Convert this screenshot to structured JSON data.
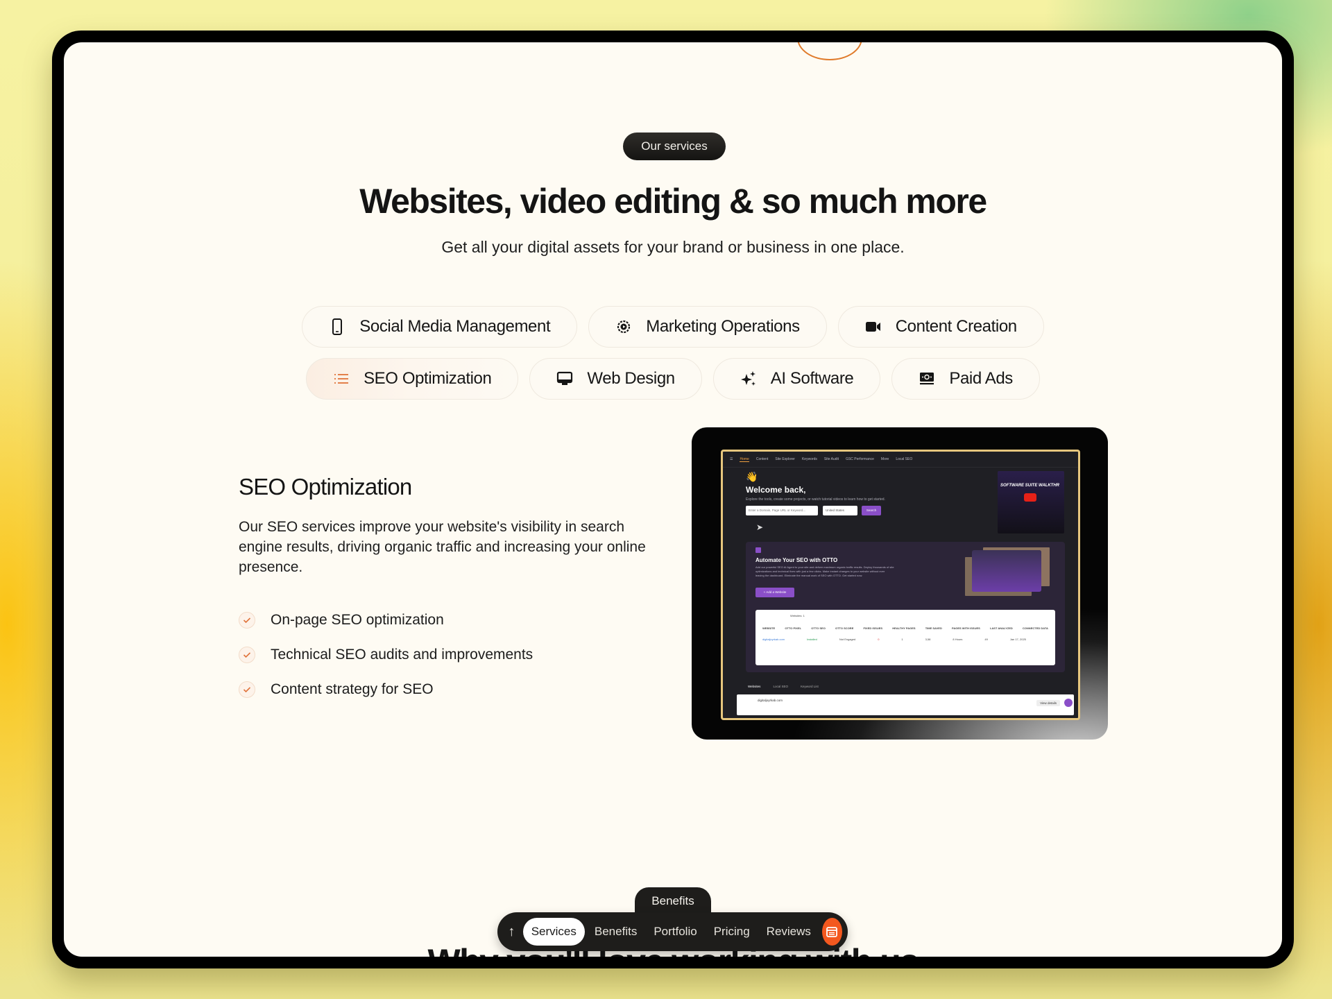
{
  "section_badge": "Our services",
  "headline": "Websites, video editing & so much more",
  "subheadline": "Get all your digital assets for your brand or business in one place.",
  "service_tabs": [
    {
      "label": "Social Media Management",
      "icon": "smartphone-icon",
      "active": false
    },
    {
      "label": "Marketing Operations",
      "icon": "gear-play-icon",
      "active": false
    },
    {
      "label": "Content Creation",
      "icon": "video-camera-icon",
      "active": false
    },
    {
      "label": "SEO Optimization",
      "icon": "list-icon",
      "active": true
    },
    {
      "label": "Web Design",
      "icon": "monitor-icon",
      "active": false
    },
    {
      "label": "AI Software",
      "icon": "sparkles-icon",
      "active": false
    },
    {
      "label": "Paid Ads",
      "icon": "money-icon",
      "active": false
    }
  ],
  "active_service": {
    "title": "SEO Optimization",
    "description": "Our SEO services improve your website's visibility in search engine results, driving organic traffic and increasing your online presence.",
    "features": [
      "On-page SEO optimization",
      "Technical SEO audits and improvements",
      "Content strategy for SEO"
    ]
  },
  "preview": {
    "nav_items": [
      "Home",
      "Content",
      "Site Explorer",
      "Keywords",
      "Site Audit",
      "GSC Performance",
      "More",
      "Local SEO"
    ],
    "welcome": "Welcome back,",
    "welcome_sub": "Explore the tools, create some projects, or watch tutorial videos to learn how to get started.",
    "search_placeholder": "Enter a Domain, Page URL or Keyword...",
    "country": "United States",
    "search_button": "Search",
    "video_title": "SOFTWARE SUITE WALKTHR",
    "otto_title": "Automate Your SEO with OTTO",
    "otto_text": "Add our powerful SEO AI Agent to your site and deliver maximum organic traffic results. Deploy thousands of site optimizations and technical fixes with just a few clicks. Make instant changes to your website without ever leaving the dashboard. Eliminate the manual work of SEO with OTTO. Get started now.",
    "otto_button": "+ Add a Website",
    "table_label": "Websites: 1",
    "table_headers": [
      "WEBSITE",
      "OTTO PIXEL",
      "OTTO SEO",
      "OTTO SCORE",
      "FIXED ISSUES",
      "HEALTHY PAGES",
      "TIME SAVED",
      "PAGES WITH ISSUES",
      "LAST ANALYZED",
      "CONNECTED DATA"
    ],
    "table_row": [
      "digitaljoyrkab.com",
      "Installed",
      "Not Engaged",
      "0",
      "1",
      "3,58",
      "8 Hours",
      "49",
      "Jan 17, 2025",
      ""
    ],
    "bottom_tabs": [
      "Websites",
      "Local SEO",
      "Keyword List"
    ],
    "bottom_site": "digitaljoyrkab.com",
    "bottom_button": "View details"
  },
  "floating_nav": {
    "tooltip": "Benefits",
    "items": [
      {
        "label": "Services",
        "active": true
      },
      {
        "label": "Benefits",
        "active": false
      },
      {
        "label": "Portfolio",
        "active": false
      },
      {
        "label": "Pricing",
        "active": false
      },
      {
        "label": "Reviews",
        "active": false
      }
    ]
  },
  "next_section_title": "Why you'll love working with us",
  "colors": {
    "accent": "#f3581f",
    "page_bg": "#fefbf3",
    "dark": "#1e1d1b",
    "check": "#e0733a"
  }
}
